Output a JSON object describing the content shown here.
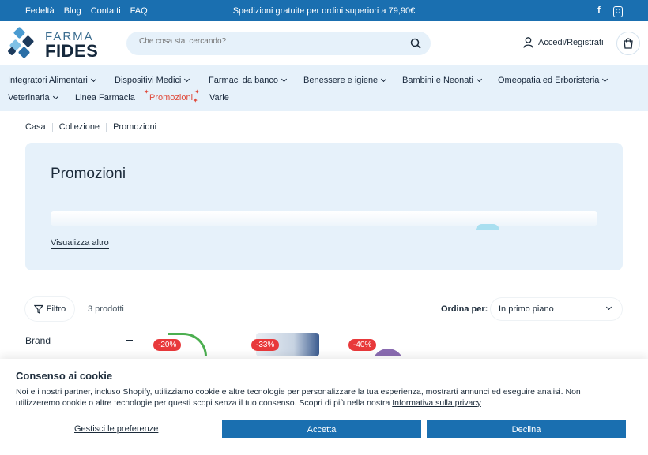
{
  "topbar": {
    "links": [
      "Fedeltà",
      "Blog",
      "Contatti",
      "FAQ"
    ],
    "promo": "Spedizioni gratuite per ordini superiori a 79,90€",
    "social": [
      "facebook-icon",
      "instagram-icon"
    ],
    "facebook_glyph": "f"
  },
  "header": {
    "logo_top": "FARMA",
    "logo_bottom": "FIDES",
    "search_placeholder": "Che cosa stai cercando?",
    "account_label": "Accedi/Registrati"
  },
  "nav": {
    "row1": [
      "Integratori Alimentari",
      "Dispositivi Medici",
      "Farmaci da banco",
      "Benessere e igiene",
      "Bambini e Neonati",
      "Omeopatia ed Erboristeria"
    ],
    "row2": [
      "Veterinaria",
      "Linea Farmacia",
      "Promozioni",
      "Varie"
    ]
  },
  "breadcrumb": [
    "Casa",
    "Collezione",
    "Promozioni"
  ],
  "hero": {
    "title": "Promozioni",
    "more_label": "Visualizza altro"
  },
  "listing": {
    "filter_label": "Filtro",
    "count": "3 prodotti",
    "sort_label": "Ordina per:",
    "sort_value": "In primo piano",
    "brand_label": "Brand",
    "badges": [
      "-20%",
      "-33%",
      "-40%"
    ]
  },
  "cookie": {
    "title": "Consenso ai cookie",
    "text": "Noi e i nostri partner, incluso Shopify, utilizziamo cookie e altre tecnologie per personalizzare la tua esperienza, mostrarti annunci ed eseguire analisi. Non utilizzeremo cookie o altre tecnologie per questi scopi senza il tuo consenso. Scopri di più nella nostra ",
    "link": "Informativa sulla privacy",
    "manage": "Gestisci le preferenze",
    "accept": "Accetta",
    "decline": "Declina"
  },
  "colors": {
    "brand_blue": "#1a6fb0",
    "light_blue": "#e6f1fa",
    "promo_red": "#e04a3b",
    "badge_red": "#e8393b"
  }
}
